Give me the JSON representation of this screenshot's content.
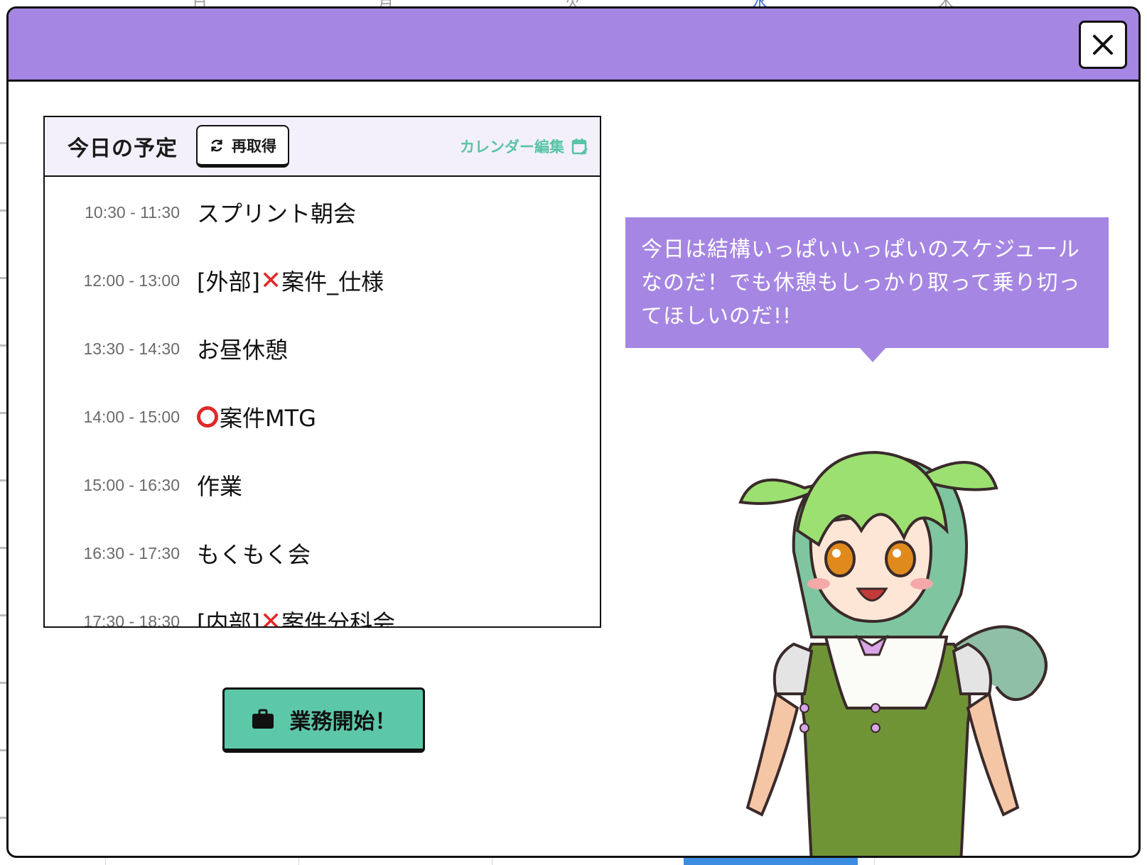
{
  "background_calendar": {
    "day_labels": [
      "日",
      "月",
      "火",
      "水",
      "木"
    ],
    "active_day_index": 3
  },
  "modal": {
    "close_label": "✕",
    "schedule": {
      "title": "今日の予定",
      "refetch_label": "再取得",
      "calendar_edit_label": "カレンダー編集",
      "events": [
        {
          "time": "10:30 - 11:30",
          "title": "スプリント朝会",
          "mark": "",
          "title_after": ""
        },
        {
          "time": "12:00 - 13:00",
          "title": "[外部]",
          "mark": "x",
          "title_after": "案件_仕様"
        },
        {
          "time": "13:30 - 14:30",
          "title": "お昼休憩",
          "mark": "",
          "title_after": ""
        },
        {
          "time": "14:00 - 15:00",
          "title": "",
          "mark": "o",
          "title_after": "案件MTG"
        },
        {
          "time": "15:00 - 16:30",
          "title": "作業",
          "mark": "",
          "title_after": ""
        },
        {
          "time": "16:30 - 17:30",
          "title": "もくもく会",
          "mark": "",
          "title_after": ""
        },
        {
          "time": "17:30 - 18:30",
          "title": "[内部]",
          "mark": "x",
          "title_after": "案件分科会"
        }
      ]
    },
    "start_button_label": "業務開始！",
    "speech_lines": [
      "今日は結構いっぱいいっぱいのスケジュール",
      "なのだ！でも休憩もしっかり取って乗り切っ",
      "てほしいのだ!!"
    ],
    "colors": {
      "header": "#a586e3",
      "accent_green": "#5dc8a8",
      "link_green": "#58c4a4",
      "mark_red": "#e0282a"
    }
  }
}
